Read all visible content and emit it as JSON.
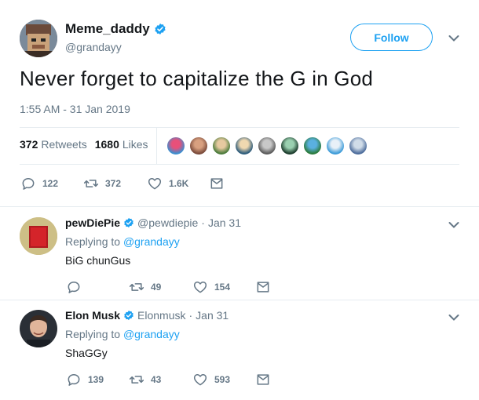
{
  "main": {
    "name": "Meme_daddy",
    "handle": "@grandayy",
    "follow_label": "Follow",
    "text": "Never forget to capitalize the G in God",
    "timestamp": "1:55 AM - 31 Jan 2019",
    "retweets_count": "372",
    "retweets_label": "Retweets",
    "likes_count": "1680",
    "likes_label": "Likes",
    "actions": {
      "replies": "122",
      "retweets": "372",
      "likes": "1.6K"
    }
  },
  "replies": [
    {
      "name": "pewDiePie",
      "handle": "@pewdiepie",
      "separator": "·",
      "date": "Jan 31",
      "replying_prefix": "Replying to",
      "replying_to": "@grandayy",
      "text": "BiG chunGus",
      "actions": {
        "replies": "",
        "retweets": "49",
        "likes": "154"
      }
    },
    {
      "name": "Elon Musk",
      "handle": "Elonmusk",
      "separator": "·",
      "date": "Jan 31",
      "replying_prefix": "Replying to",
      "replying_to": "@grandayy",
      "text": "ShaGGy",
      "actions": {
        "replies": "139",
        "retweets": "43",
        "likes": "593"
      }
    }
  ],
  "colors": {
    "accent": "#1da1f2",
    "muted": "#657786",
    "text": "#14171a",
    "divider": "#e6ecf0"
  },
  "icons": [
    "verified-badge-icon",
    "chevron-down-icon",
    "reply-icon",
    "retweet-icon",
    "like-icon",
    "dm-icon"
  ]
}
